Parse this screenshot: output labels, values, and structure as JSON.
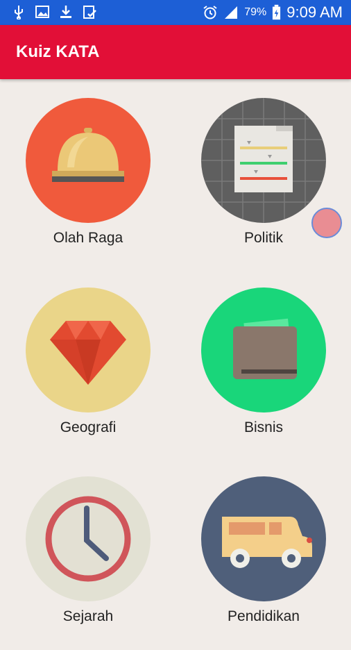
{
  "status_bar": {
    "icons": [
      "usb-icon",
      "image-icon",
      "download-icon",
      "clipboard-check-icon",
      "alarm-icon",
      "signal-icon",
      "battery-charging-icon"
    ],
    "battery": "79%",
    "time": "9:09 AM"
  },
  "app_bar": {
    "title": "Kuiz KATA",
    "color": "#e20f37"
  },
  "categories": [
    {
      "label": "Olah Raga",
      "icon": "service-bell-icon",
      "color": "#f05a3c"
    },
    {
      "label": "Politik",
      "icon": "document-icon",
      "color": "#5f5f5f"
    },
    {
      "label": "Geografi",
      "icon": "diamond-icon",
      "color": "#ead589"
    },
    {
      "label": "Bisnis",
      "icon": "wallet-icon",
      "color": "#19d67a"
    },
    {
      "label": "Sejarah",
      "icon": "clock-icon",
      "color": "#e2e1d3"
    },
    {
      "label": "Pendidikan",
      "icon": "school-bus-icon",
      "color": "#4f5f7a"
    }
  ]
}
